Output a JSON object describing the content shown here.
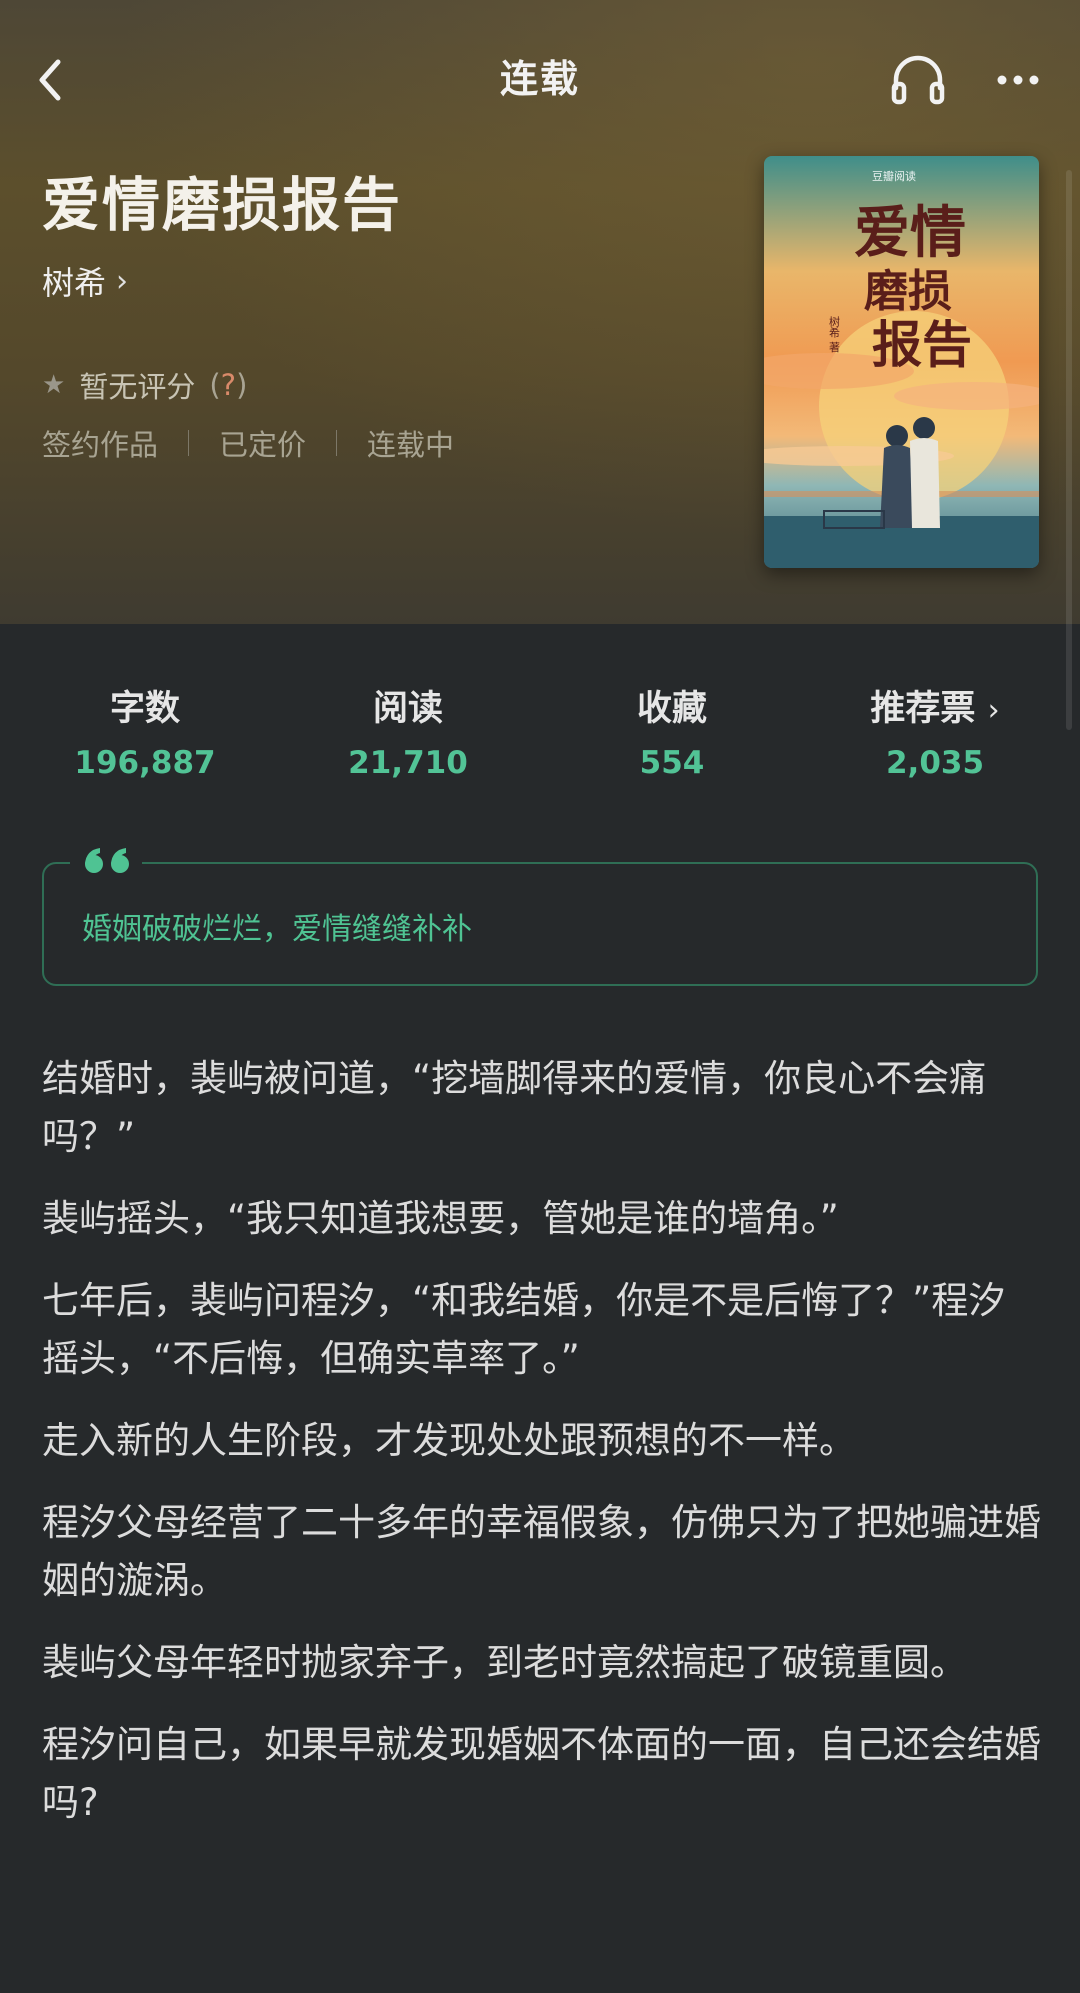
{
  "header": {
    "title": "连载"
  },
  "book": {
    "title": "爱情磨损报告",
    "author": "树希",
    "author_chevron": "›",
    "rating_text": "暂无评分",
    "rating_help_open": "(",
    "rating_help": "?",
    "rating_help_close": ")",
    "tags": [
      "签约作品",
      "已定价",
      "连载中"
    ]
  },
  "cover": {
    "publisher": "豆瓣阅读",
    "title_lines": [
      "爱情",
      "磨损",
      "报告"
    ],
    "author_credit": "树希 著"
  },
  "stats": [
    {
      "label": "字数",
      "value": "196,887"
    },
    {
      "label": "阅读",
      "value": "21,710"
    },
    {
      "label": "收藏",
      "value": "554"
    },
    {
      "label": "推荐票",
      "value": "2,035",
      "chevron": "›"
    }
  ],
  "tagline": {
    "mark": "❝",
    "text": "婚姻破破烂烂，爱情缝缝补补"
  },
  "blurb": [
    "结婚时，裴屿被问道，“挖墙脚得来的爱情，你良心不会痛吗？”",
    "裴屿摇头，“我只知道我想要，管她是谁的墙角。”",
    "七年后，裴屿问程汐，“和我结婚，你是不是后悔了？”程汐摇头，“不后悔，但确实草率了。”",
    "走入新的人生阶段，才发现处处跟预想的不一样。",
    "程汐父母经营了二十多年的幸福假象，仿佛只为了把她骗进婚姻的漩涡。",
    "裴屿父母年轻时抛家弃子，到老时竟然搞起了破镜重圆。",
    "程汐问自己，如果早就发现婚姻不体面的一面，自己还会结婚吗?"
  ],
  "icons": {
    "back": "back-arrow-icon",
    "headphones": "headphones-icon",
    "more": "more-dots-icon",
    "star": "star-icon",
    "quote": "quote-mark-icon"
  },
  "colors": {
    "accent": "#52c396",
    "background": "#26292b",
    "hero": "#5c4f2c"
  }
}
